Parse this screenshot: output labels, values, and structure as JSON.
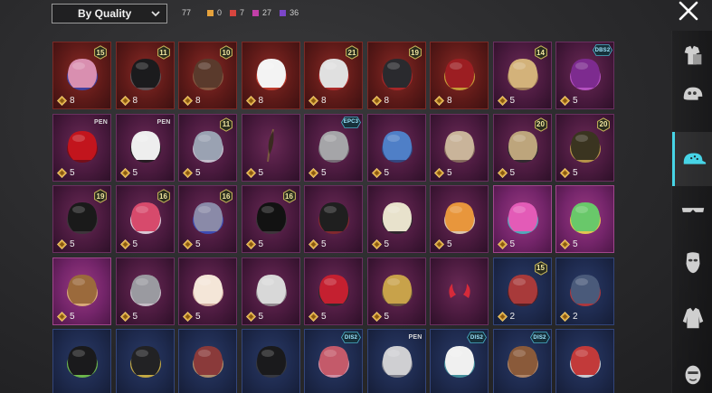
{
  "sort": {
    "label": "By Quality"
  },
  "counts": {
    "total": "77",
    "legendary": {
      "value": "0",
      "color": "#e6a23c"
    },
    "epic": {
      "value": "7",
      "color": "#d6453e"
    },
    "rare": {
      "value": "27",
      "color": "#c23fa8"
    },
    "uncommon": {
      "value": "36",
      "color": "#7b46c9"
    }
  },
  "items": [
    {
      "quality": "red",
      "badge": "15",
      "cost": "8",
      "icon": "pink-hair-hat-icon"
    },
    {
      "quality": "red",
      "badge": "11",
      "cost": "8",
      "icon": "black-helmet-icon"
    },
    {
      "quality": "red",
      "badge": "10",
      "cost": "8",
      "icon": "brown-hair-icon"
    },
    {
      "quality": "red",
      "badge": "",
      "cost": "8",
      "icon": "white-cowboy-hat-icon"
    },
    {
      "quality": "red",
      "badge": "21",
      "cost": "8",
      "icon": "clown-mask-icon"
    },
    {
      "quality": "red",
      "badge": "19",
      "cost": "8",
      "icon": "dark-helmet-icon"
    },
    {
      "quality": "red",
      "badge": "",
      "cost": "8",
      "icon": "red-star-helmet-icon"
    },
    {
      "quality": "purple",
      "badge": "14",
      "cost": "5",
      "icon": "blonde-hair-icon"
    },
    {
      "quality": "purple",
      "tag": "DBS2",
      "cost": "5",
      "icon": "purple-hair-icon"
    },
    {
      "quality": "purple",
      "tag": "PEN",
      "cost": "5",
      "icon": "red-hair-icon"
    },
    {
      "quality": "purple",
      "tag": "PEN",
      "cost": "5",
      "icon": "panda-mask-icon"
    },
    {
      "quality": "purple",
      "badge": "11",
      "cost": "5",
      "icon": "silver-hair-icon"
    },
    {
      "quality": "purple",
      "badge": "",
      "cost": "5",
      "icon": "feather-icon"
    },
    {
      "quality": "purple",
      "tag": "EPC3",
      "cost": "5",
      "icon": "gray-hair-icon"
    },
    {
      "quality": "purple",
      "badge": "",
      "cost": "5",
      "icon": "blue-tentacle-icon"
    },
    {
      "quality": "purple",
      "badge": "",
      "cost": "5",
      "icon": "braided-hair-icon"
    },
    {
      "quality": "purple",
      "badge": "20",
      "cost": "5",
      "icon": "bunny-hood-icon"
    },
    {
      "quality": "purple",
      "badge": "20",
      "cost": "5",
      "icon": "gold-helmet-icon"
    },
    {
      "quality": "purple",
      "badge": "19",
      "cost": "5",
      "icon": "crow-mask-icon"
    },
    {
      "quality": "purple",
      "badge": "16",
      "cost": "5",
      "icon": "uncle-sam-hat-icon"
    },
    {
      "quality": "purple",
      "badge": "16",
      "cost": "5",
      "icon": "blue-flower-hair-icon"
    },
    {
      "quality": "purple",
      "badge": "16",
      "cost": "5",
      "icon": "black-hair-icon"
    },
    {
      "quality": "purple",
      "badge": "",
      "cost": "5",
      "icon": "samurai-mask-icon"
    },
    {
      "quality": "purple",
      "badge": "",
      "cost": "5",
      "icon": "witch-hat-icon"
    },
    {
      "quality": "purple",
      "badge": "",
      "cost": "5",
      "icon": "candle-crown-icon"
    },
    {
      "quality": "pink",
      "badge": "",
      "cost": "5",
      "icon": "pink-flower-hat-icon"
    },
    {
      "quality": "pink",
      "badge": "",
      "cost": "5",
      "icon": "green-mask-icon"
    },
    {
      "quality": "pink",
      "badge": "",
      "cost": "5",
      "icon": "striped-cap-icon"
    },
    {
      "quality": "purple",
      "badge": "",
      "cost": "5",
      "icon": "wolf-mask-icon"
    },
    {
      "quality": "purple",
      "badge": "",
      "cost": "5",
      "icon": "sheep-mask-icon"
    },
    {
      "quality": "purple",
      "badge": "",
      "cost": "5",
      "icon": "skull-hair-icon"
    },
    {
      "quality": "purple",
      "badge": "",
      "cost": "5",
      "icon": "red-band-hair-icon"
    },
    {
      "quality": "purple",
      "badge": "",
      "cost": "5",
      "icon": "gold-crown-icon"
    },
    {
      "quality": "purple",
      "badge": "",
      "cost": "",
      "icon": "red-horns-icon"
    },
    {
      "quality": "blue",
      "badge": "15",
      "cost": "2",
      "icon": "red-feather-icon"
    },
    {
      "quality": "blue",
      "badge": "",
      "cost": "2",
      "icon": "blue-cap-icon"
    },
    {
      "quality": "blue",
      "badge": "",
      "cost": "",
      "icon": "green-visor-helmet-icon"
    },
    {
      "quality": "blue",
      "badge": "",
      "cost": "",
      "icon": "gold-visor-helmet-icon"
    },
    {
      "quality": "blue",
      "badge": "",
      "cost": "",
      "icon": "red-helmet-icon"
    },
    {
      "quality": "blue",
      "badge": "",
      "cost": "",
      "icon": "black-beanie-icon"
    },
    {
      "quality": "blue",
      "tag": "DIS2",
      "cost": "",
      "icon": "red-bandana-icon"
    },
    {
      "quality": "blue",
      "tag": "PEN",
      "cost": "",
      "icon": "white-hair-icon"
    },
    {
      "quality": "blue",
      "tag": "DIS2",
      "cost": "",
      "icon": "chef-hat-icon"
    },
    {
      "quality": "blue",
      "tag": "DIS2",
      "cost": "",
      "icon": "donkey-mask-icon"
    },
    {
      "quality": "blue",
      "badge": "",
      "cost": "",
      "icon": "racing-helmet-icon"
    }
  ],
  "sidebar": [
    {
      "name": "tab-outfit",
      "icon": "outfit-icon",
      "active": false
    },
    {
      "name": "tab-helmet",
      "icon": "helmet-icon",
      "active": false
    },
    {
      "name": "tab-headwear",
      "icon": "cap-icon",
      "active": true
    },
    {
      "name": "tab-eyewear",
      "icon": "glasses-icon",
      "active": false
    },
    {
      "name": "tab-mask",
      "icon": "mask-icon",
      "active": false
    },
    {
      "name": "tab-top",
      "icon": "jacket-icon",
      "active": false
    },
    {
      "name": "tab-face",
      "icon": "face-icon",
      "active": false
    }
  ]
}
